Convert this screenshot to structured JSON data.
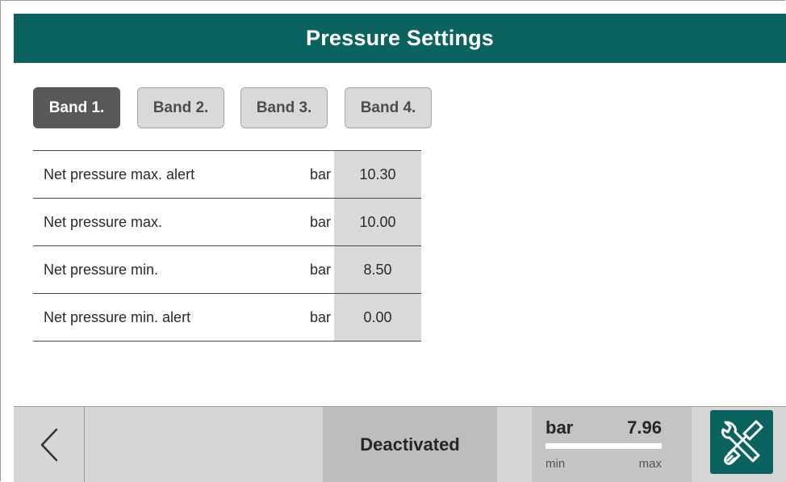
{
  "header": {
    "title": "Pressure Settings"
  },
  "tabs": [
    {
      "label": "Band 1.",
      "active": true
    },
    {
      "label": "Band 2.",
      "active": false
    },
    {
      "label": "Band 3.",
      "active": false
    },
    {
      "label": "Band 4.",
      "active": false
    }
  ],
  "settings": [
    {
      "label": "Net pressure max. alert",
      "unit": "bar",
      "value": "10.30"
    },
    {
      "label": "Net pressure max.",
      "unit": "bar",
      "value": "10.00"
    },
    {
      "label": "Net pressure min.",
      "unit": "bar",
      "value": "8.50"
    },
    {
      "label": "Net pressure min. alert",
      "unit": "bar",
      "value": "0.00"
    }
  ],
  "footer": {
    "back_icon": "chevron-left-icon",
    "status": "Deactivated",
    "gauge": {
      "unit": "bar",
      "value": "7.96",
      "min_label": "min",
      "max_label": "max"
    },
    "tools_icon": "wrench-screwdriver-icon"
  },
  "colors": {
    "header_bg": "#0b6360",
    "active_tab": "#585858",
    "inactive_tab": "#d9d9d9",
    "value_cell": "#d9d9d9",
    "tools_button": "#0b6360"
  }
}
